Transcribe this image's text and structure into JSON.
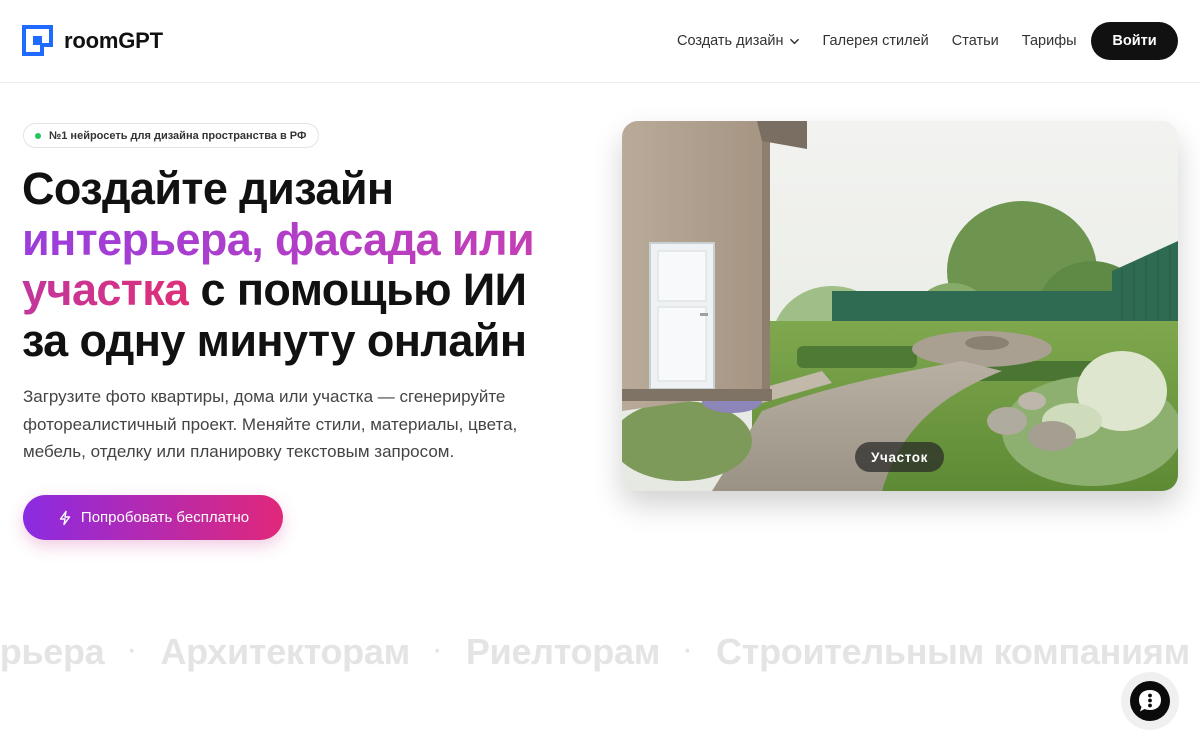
{
  "brand": {
    "name": "roomGPT",
    "color": "#1f6bff"
  },
  "nav": {
    "items": [
      {
        "label": "Создать дизайн",
        "has_dropdown": true
      },
      {
        "label": "Галерея стилей"
      },
      {
        "label": "Статьи"
      },
      {
        "label": "Тарифы"
      }
    ],
    "login_label": "Войти"
  },
  "hero": {
    "badge": "№1 нейросеть для дизайна пространства в РФ",
    "title": {
      "line1": "Создайте дизайн",
      "highlight1": "интерьера, фасада или",
      "highlight2": "участка",
      "line3_rest": " с помощью ИИ",
      "line4": "за одну минуту онлайн"
    },
    "subtitle": "Загрузите фото квартиры, дома или участка — сгенерируйте фотореалистичный проект. Меняйте стили, материалы, цвета, мебель, отделку или планировку текстовым запросом.",
    "cta_label": "Попробовать бесплатно",
    "image_label": "Участок"
  },
  "marquee": {
    "items": [
      "Дизайнерам интерьера",
      "Архитекторам",
      "Риелторам",
      "Строительным компаниям"
    ],
    "visible_first": "ерьера"
  },
  "colors": {
    "accent_purple": "#8b2be2",
    "accent_pink": "#e0287a",
    "badge_dot": "#22c55e",
    "dark_button": "#111111"
  },
  "icons": {
    "logo": "logo-mark-icon",
    "dropdown": "chevron-down-icon",
    "cta": "lightning-icon",
    "chat": "chat-icon"
  }
}
